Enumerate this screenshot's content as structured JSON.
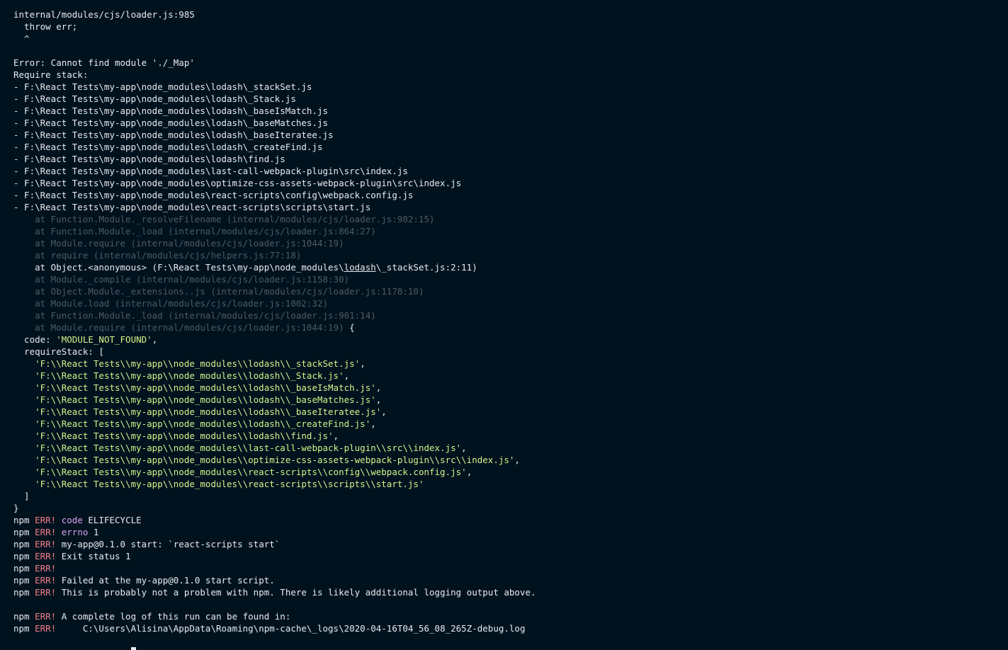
{
  "header": [
    "internal/modules/cjs/loader.js:985",
    "  throw err;",
    "  ^",
    "",
    "Error: Cannot find module './_Map'",
    "Require stack:"
  ],
  "require_stack": [
    "- F:\\React Tests\\my-app\\node_modules\\lodash\\_stackSet.js",
    "- F:\\React Tests\\my-app\\node_modules\\lodash\\_Stack.js",
    "- F:\\React Tests\\my-app\\node_modules\\lodash\\_baseIsMatch.js",
    "- F:\\React Tests\\my-app\\node_modules\\lodash\\_baseMatches.js",
    "- F:\\React Tests\\my-app\\node_modules\\lodash\\_baseIteratee.js",
    "- F:\\React Tests\\my-app\\node_modules\\lodash\\_createFind.js",
    "- F:\\React Tests\\my-app\\node_modules\\lodash\\find.js",
    "- F:\\React Tests\\my-app\\node_modules\\last-call-webpack-plugin\\src\\index.js",
    "- F:\\React Tests\\my-app\\node_modules\\optimize-css-assets-webpack-plugin\\src\\index.js",
    "- F:\\React Tests\\my-app\\node_modules\\react-scripts\\config\\webpack.config.js",
    "- F:\\React Tests\\my-app\\node_modules\\react-scripts\\scripts\\start.js"
  ],
  "trace_dim_top": [
    "    at Function.Module._resolveFilename (internal/modules/cjs/loader.js:982:15)",
    "    at Function.Module._load (internal/modules/cjs/loader.js:864:27)",
    "    at Module.require (internal/modules/cjs/loader.js:1044:19)",
    "    at require (internal/modules/cjs/helpers.js:77:18)"
  ],
  "trace_highlight": {
    "prefix": "    at Object.<anonymous> (F:\\React Tests\\my-app\\node_modules\\",
    "underlined": "lodash",
    "suffix": "\\_stackSet.js:2:11)"
  },
  "trace_dim_bottom": [
    "    at Module._compile (internal/modules/cjs/loader.js:1158:30)",
    "    at Object.Module._extensions..js (internal/modules/cjs/loader.js:1178:10)",
    "    at Module.load (internal/modules/cjs/loader.js:1002:32)",
    "    at Function.Module._load (internal/modules/cjs/loader.js:901:14)"
  ],
  "trace_last": {
    "dim": "    at Module.require (internal/modules/cjs/loader.js:1044:19)",
    "brace": " {"
  },
  "code_line": {
    "key": "  code: ",
    "value": "'MODULE_NOT_FOUND'",
    "tail": ","
  },
  "require_stack_open": "  requireStack: [",
  "require_stack_strings": [
    "'F:\\\\React Tests\\\\my-app\\\\node_modules\\\\lodash\\\\_stackSet.js'",
    "'F:\\\\React Tests\\\\my-app\\\\node_modules\\\\lodash\\\\_Stack.js'",
    "'F:\\\\React Tests\\\\my-app\\\\node_modules\\\\lodash\\\\_baseIsMatch.js'",
    "'F:\\\\React Tests\\\\my-app\\\\node_modules\\\\lodash\\\\_baseMatches.js'",
    "'F:\\\\React Tests\\\\my-app\\\\node_modules\\\\lodash\\\\_baseIteratee.js'",
    "'F:\\\\React Tests\\\\my-app\\\\node_modules\\\\lodash\\\\_createFind.js'",
    "'F:\\\\React Tests\\\\my-app\\\\node_modules\\\\lodash\\\\find.js'",
    "'F:\\\\React Tests\\\\my-app\\\\node_modules\\\\last-call-webpack-plugin\\\\src\\\\index.js'",
    "'F:\\\\React Tests\\\\my-app\\\\node_modules\\\\optimize-css-assets-webpack-plugin\\\\src\\\\index.js'",
    "'F:\\\\React Tests\\\\my-app\\\\node_modules\\\\react-scripts\\\\config\\\\webpack.config.js'",
    "'F:\\\\React Tests\\\\my-app\\\\node_modules\\\\react-scripts\\\\scripts\\\\start.js'"
  ],
  "require_stack_close": "  ]",
  "object_close": "}",
  "npm": {
    "prefix": "npm ",
    "err_label": "ERR!",
    "lines": [
      {
        "kw": "code",
        "text": " ELIFECYCLE"
      },
      {
        "kw": "errno",
        "text": " 1"
      },
      {
        "kw": "",
        "text": " my-app@0.1.0 start: `react-scripts start`"
      },
      {
        "kw": "",
        "text": " Exit status 1"
      },
      {
        "kw": "",
        "text": ""
      },
      {
        "kw": "",
        "text": " Failed at the my-app@0.1.0 start script."
      },
      {
        "kw": "",
        "text": " This is probably not a problem with npm. There is likely additional logging output above."
      }
    ],
    "log_lines": [
      " A complete log of this run can be found in:",
      "     C:\\Users\\Alisina\\AppData\\Roaming\\npm-cache\\_logs\\2020-04-16T04_56_08_265Z-debug.log"
    ]
  },
  "colors": {
    "background": "#01121f",
    "text": "#e8ecef",
    "dim": "#4f5a66",
    "string": "#d4f48a",
    "error": "#f47e88",
    "keyword": "#d8a4f2"
  }
}
